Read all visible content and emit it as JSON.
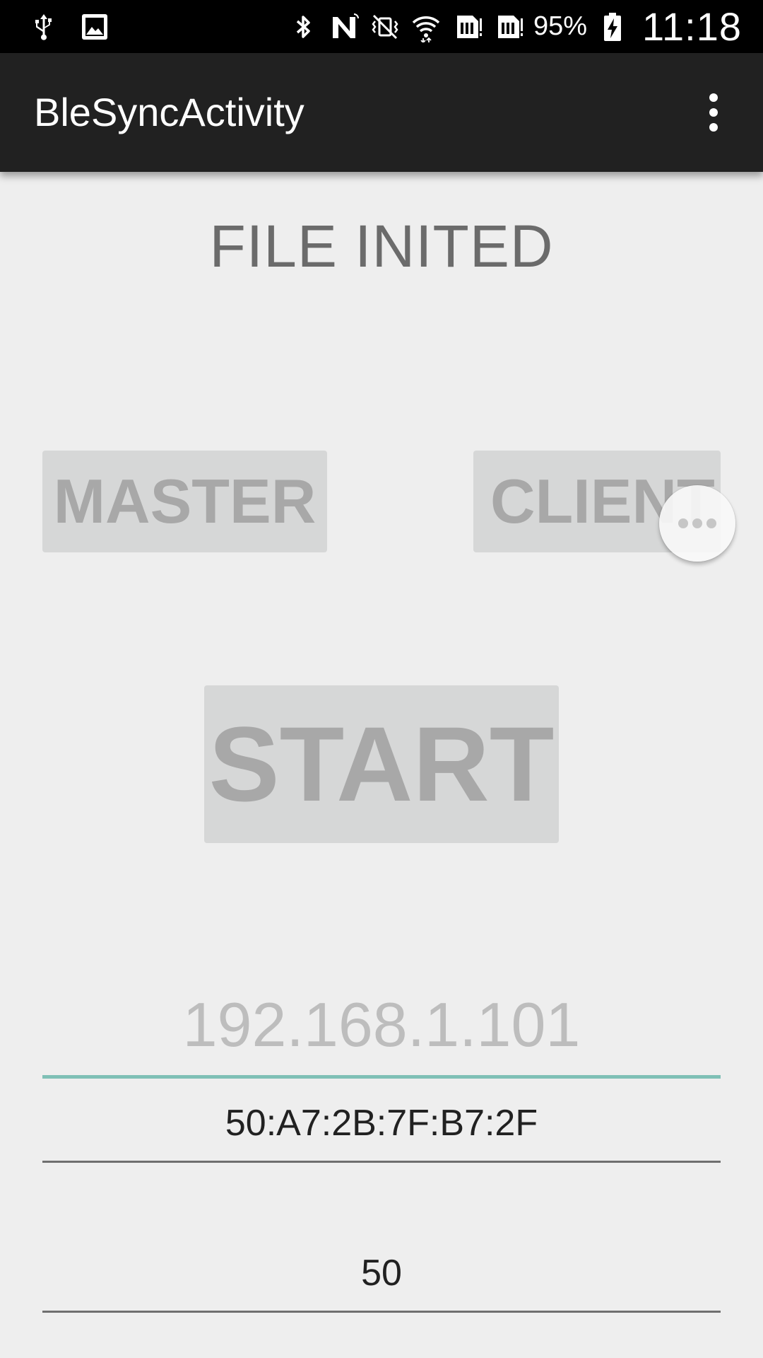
{
  "status_bar": {
    "battery_percent": "95%",
    "time": "11:18",
    "icons": [
      "usb-icon",
      "image-icon",
      "bluetooth-icon",
      "nfc-icon",
      "vibrate-icon",
      "wifi-icon",
      "sim1-icon",
      "sim2-icon",
      "battery-charging-icon"
    ]
  },
  "app_bar": {
    "title": "BleSyncActivity",
    "menu_icon": "overflow-menu-icon"
  },
  "main": {
    "status_text": "FILE INITED",
    "master_button": "MASTER",
    "client_button": "CLIENT",
    "start_button": "START",
    "ip_field": {
      "value": "",
      "placeholder": "192.168.1.101"
    },
    "mac_field": {
      "value": "50:A7:2B:7F:B7:2F"
    },
    "number_field": {
      "value": "50"
    }
  },
  "floating_bubble": {
    "icon": "more-dots-icon"
  },
  "colors": {
    "status_bar_bg": "#000000",
    "app_bar_bg": "#212121",
    "page_bg": "#eeeeee",
    "button_bg": "#d6d7d7",
    "button_text": "#a8a8a8",
    "focused_underline": "#7fc0b6"
  }
}
